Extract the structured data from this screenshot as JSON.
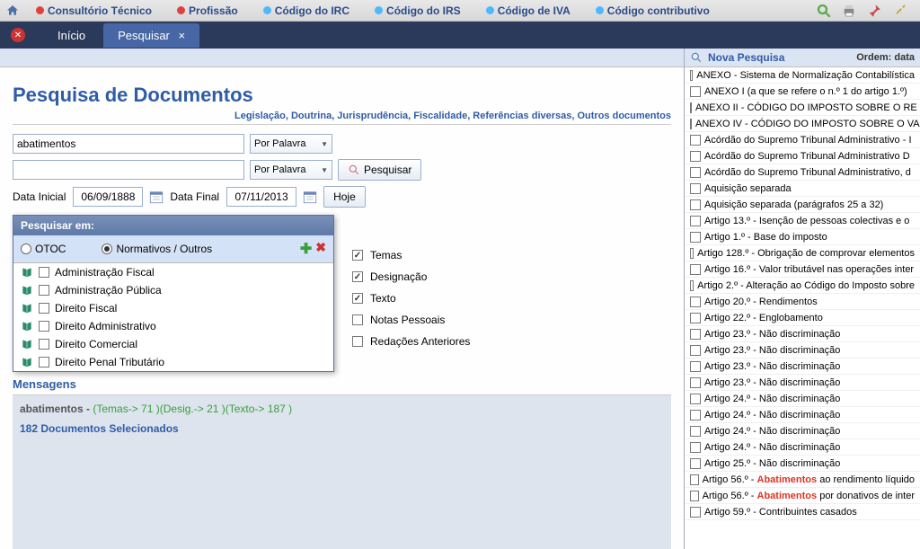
{
  "topnav": {
    "items": [
      {
        "label": "Consultório Técnico",
        "dot": "red"
      },
      {
        "label": "Profissão",
        "dot": "red"
      },
      {
        "label": "Código do IRC",
        "dot": "blue"
      },
      {
        "label": "Código do IRS",
        "dot": "blue"
      },
      {
        "label": "Código de IVA",
        "dot": "blue"
      },
      {
        "label": "Código contributivo",
        "dot": "blue"
      }
    ]
  },
  "tabs": {
    "inicio": "Início",
    "pesquisar": "Pesquisar"
  },
  "page": {
    "title": "Pesquisa de Documentos",
    "subtitle": "Legislação, Doutrina, Jurisprudência, Fiscalidade, Referências diversas, Outros documentos"
  },
  "form": {
    "term1": "abatimentos",
    "term2": "",
    "por_palavra": "Por Palavra",
    "pesquisar_btn": "Pesquisar",
    "data_inicial_label": "Data Inicial",
    "data_inicial": "06/09/1888",
    "data_final_label": "Data Final",
    "data_final": "07/11/2013",
    "hoje_btn": "Hoje"
  },
  "search_in": {
    "header": "Pesquisar em:",
    "otoc": "OTOC",
    "normativos": "Normativos / Outros",
    "categories": [
      "Administração Fiscal",
      "Administração Pública",
      "Direito Fiscal",
      "Direito Administrativo",
      "Direito Comercial",
      "Direito Penal Tributário"
    ]
  },
  "filters": {
    "temas": "Temas",
    "designacao": "Designação",
    "texto": "Texto",
    "notas": "Notas Pessoais",
    "redacoes": "Redações Anteriores"
  },
  "messages": {
    "label": "Mensagens",
    "term": "abatimentos",
    "counts": "(Temas-> 71 )(Desig.-> 21 )(Texto-> 187 )",
    "selected": "182 Documentos Selecionados"
  },
  "right": {
    "title": "Nova Pesquisa",
    "order_label": "Ordem: data",
    "results": [
      {
        "text": "ANEXO - Sistema de Normalização Contabilística"
      },
      {
        "text": "ANEXO I (a que se refere o n.º 1 do artigo 1.º)"
      },
      {
        "text": "ANEXO II - CÓDIGO DO IMPOSTO SOBRE O RE"
      },
      {
        "text": "ANEXO IV - CÓDIGO DO IMPOSTO SOBRE O VA"
      },
      {
        "text": "Acórdão do Supremo Tribunal Administrativo - I"
      },
      {
        "text": "Acórdão do Supremo Tribunal Administrativo D"
      },
      {
        "text": "Acórdão do Supremo Tribunal Administrativo, d"
      },
      {
        "text": "Aquisição separada"
      },
      {
        "text": "Aquisição separada (parágrafos 25 a 32)"
      },
      {
        "text": "Artigo  13.º - Isenção de pessoas colectivas e o"
      },
      {
        "text": "Artigo 1.º - Base do imposto"
      },
      {
        "text": "Artigo 128.º - Obrigação de comprovar elementos"
      },
      {
        "text": "Artigo 16.º - Valor tributável nas operações inter"
      },
      {
        "text": "Artigo 2.º - Alteração ao Código do Imposto sobre"
      },
      {
        "text": "Artigo 20.º - Rendimentos"
      },
      {
        "text": "Artigo 22.º - Englobamento"
      },
      {
        "text": "Artigo 23.º - Não discriminação"
      },
      {
        "text": "Artigo 23.º - Não discriminação"
      },
      {
        "text": "Artigo 23.º - Não discriminação"
      },
      {
        "text": "Artigo 23.º - Não discriminação"
      },
      {
        "text": "Artigo 24.º - Não discriminação"
      },
      {
        "text": "Artigo 24.º - Não discriminação"
      },
      {
        "text": "Artigo 24.º - Não discriminação"
      },
      {
        "text": "Artigo 24.º - Não discriminação"
      },
      {
        "text": "Artigo 25.º - Não discriminação"
      },
      {
        "text": "Artigo 56.º - ",
        "hl": "Abatimentos",
        "after": " ao rendimento líquido"
      },
      {
        "text": "Artigo 56.º - ",
        "hl": "Abatimentos",
        "after": " por donativos de inter"
      },
      {
        "text": "Artigo 59.º - Contribuintes casados"
      }
    ]
  }
}
